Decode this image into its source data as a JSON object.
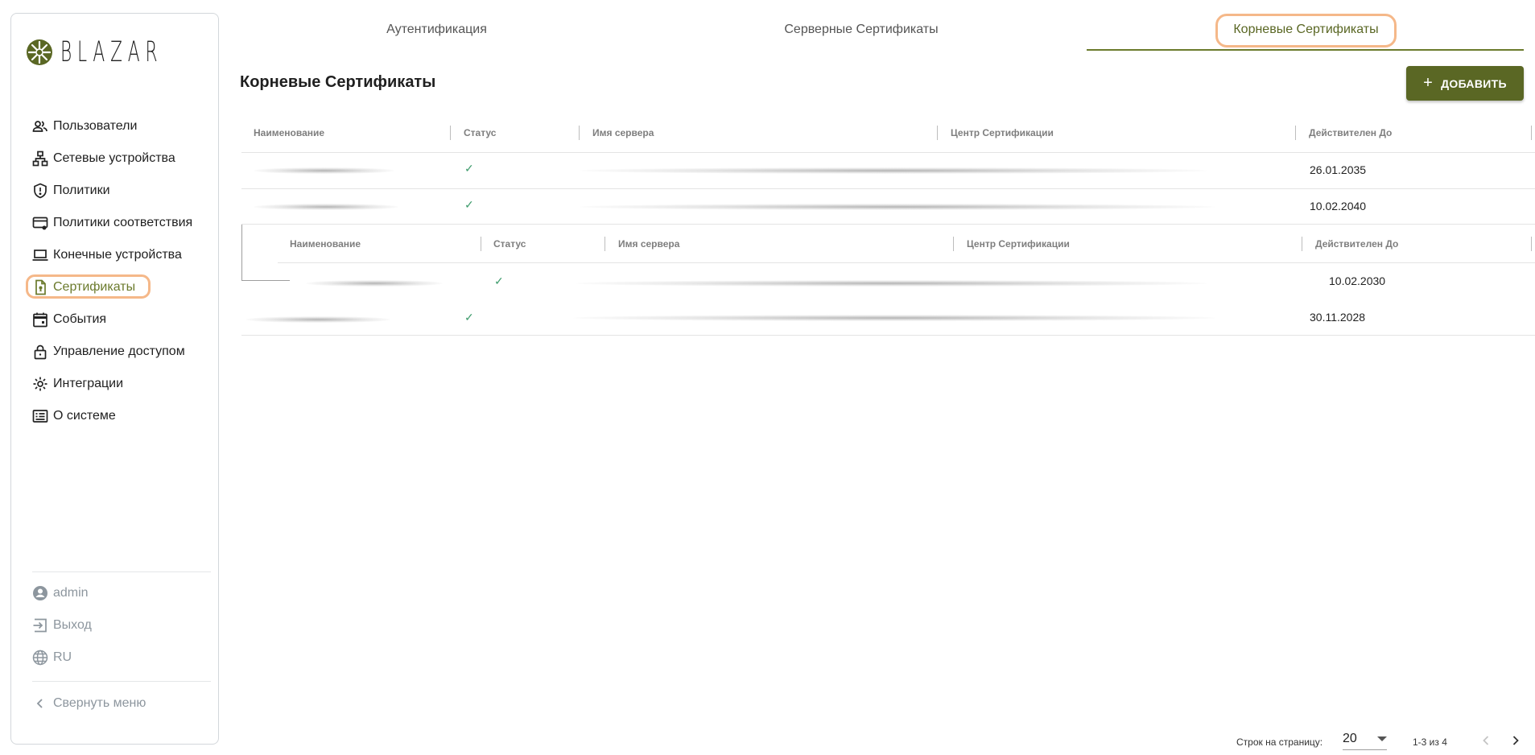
{
  "app": {
    "logo_text": "BLAZAR"
  },
  "sidebar": {
    "items": [
      {
        "label": "Пользователи",
        "icon": "users-icon"
      },
      {
        "label": "Сетевые устройства",
        "icon": "network-icon"
      },
      {
        "label": "Политики",
        "icon": "shield-icon"
      },
      {
        "label": "Политики соответствия",
        "icon": "card-icon"
      },
      {
        "label": "Конечные устройства",
        "icon": "laptop-icon"
      },
      {
        "label": "Сертификаты",
        "icon": "certificate-icon",
        "active": true
      },
      {
        "label": "События",
        "icon": "calendar-icon"
      },
      {
        "label": "Управление доступом",
        "icon": "lock-icon"
      },
      {
        "label": "Интеграции",
        "icon": "gear-icon"
      },
      {
        "label": "О системе",
        "icon": "info-icon"
      }
    ],
    "user": "admin",
    "logout": "Выход",
    "language": "RU",
    "collapse": "Свернуть меню"
  },
  "tabs": [
    {
      "label": "Аутентификация"
    },
    {
      "label": "Серверные Сертификаты"
    },
    {
      "label": "Корневые Сертификаты",
      "active": true
    }
  ],
  "page": {
    "title": "Корневые Сертификаты",
    "add_label": "ДОБАВИТЬ"
  },
  "table": {
    "columns": [
      "Наименование",
      "Статус",
      "Имя сервера",
      "Центр Сертификации",
      "Действителен До"
    ],
    "rows": [
      {
        "status": "✓",
        "valid_to": "26.01.2035"
      },
      {
        "status": "✓",
        "valid_to": "10.02.2040"
      }
    ],
    "nested": {
      "columns": [
        "Наименование",
        "Статус",
        "Имя сервера",
        "Центр Сертификации",
        "Действителен До"
      ],
      "rows": [
        {
          "status": "✓",
          "valid_to": "10.02.2030"
        }
      ]
    },
    "rows_after": [
      {
        "status": "✓",
        "valid_to": "30.11.2028"
      }
    ]
  },
  "pagination": {
    "rows_label": "Строк на страницу:",
    "rows_per_page": "20",
    "range": "1-3 из 4"
  },
  "colors": {
    "accent": "#5a6724",
    "highlight": "#f5b889",
    "check": "#3f9c6d"
  }
}
